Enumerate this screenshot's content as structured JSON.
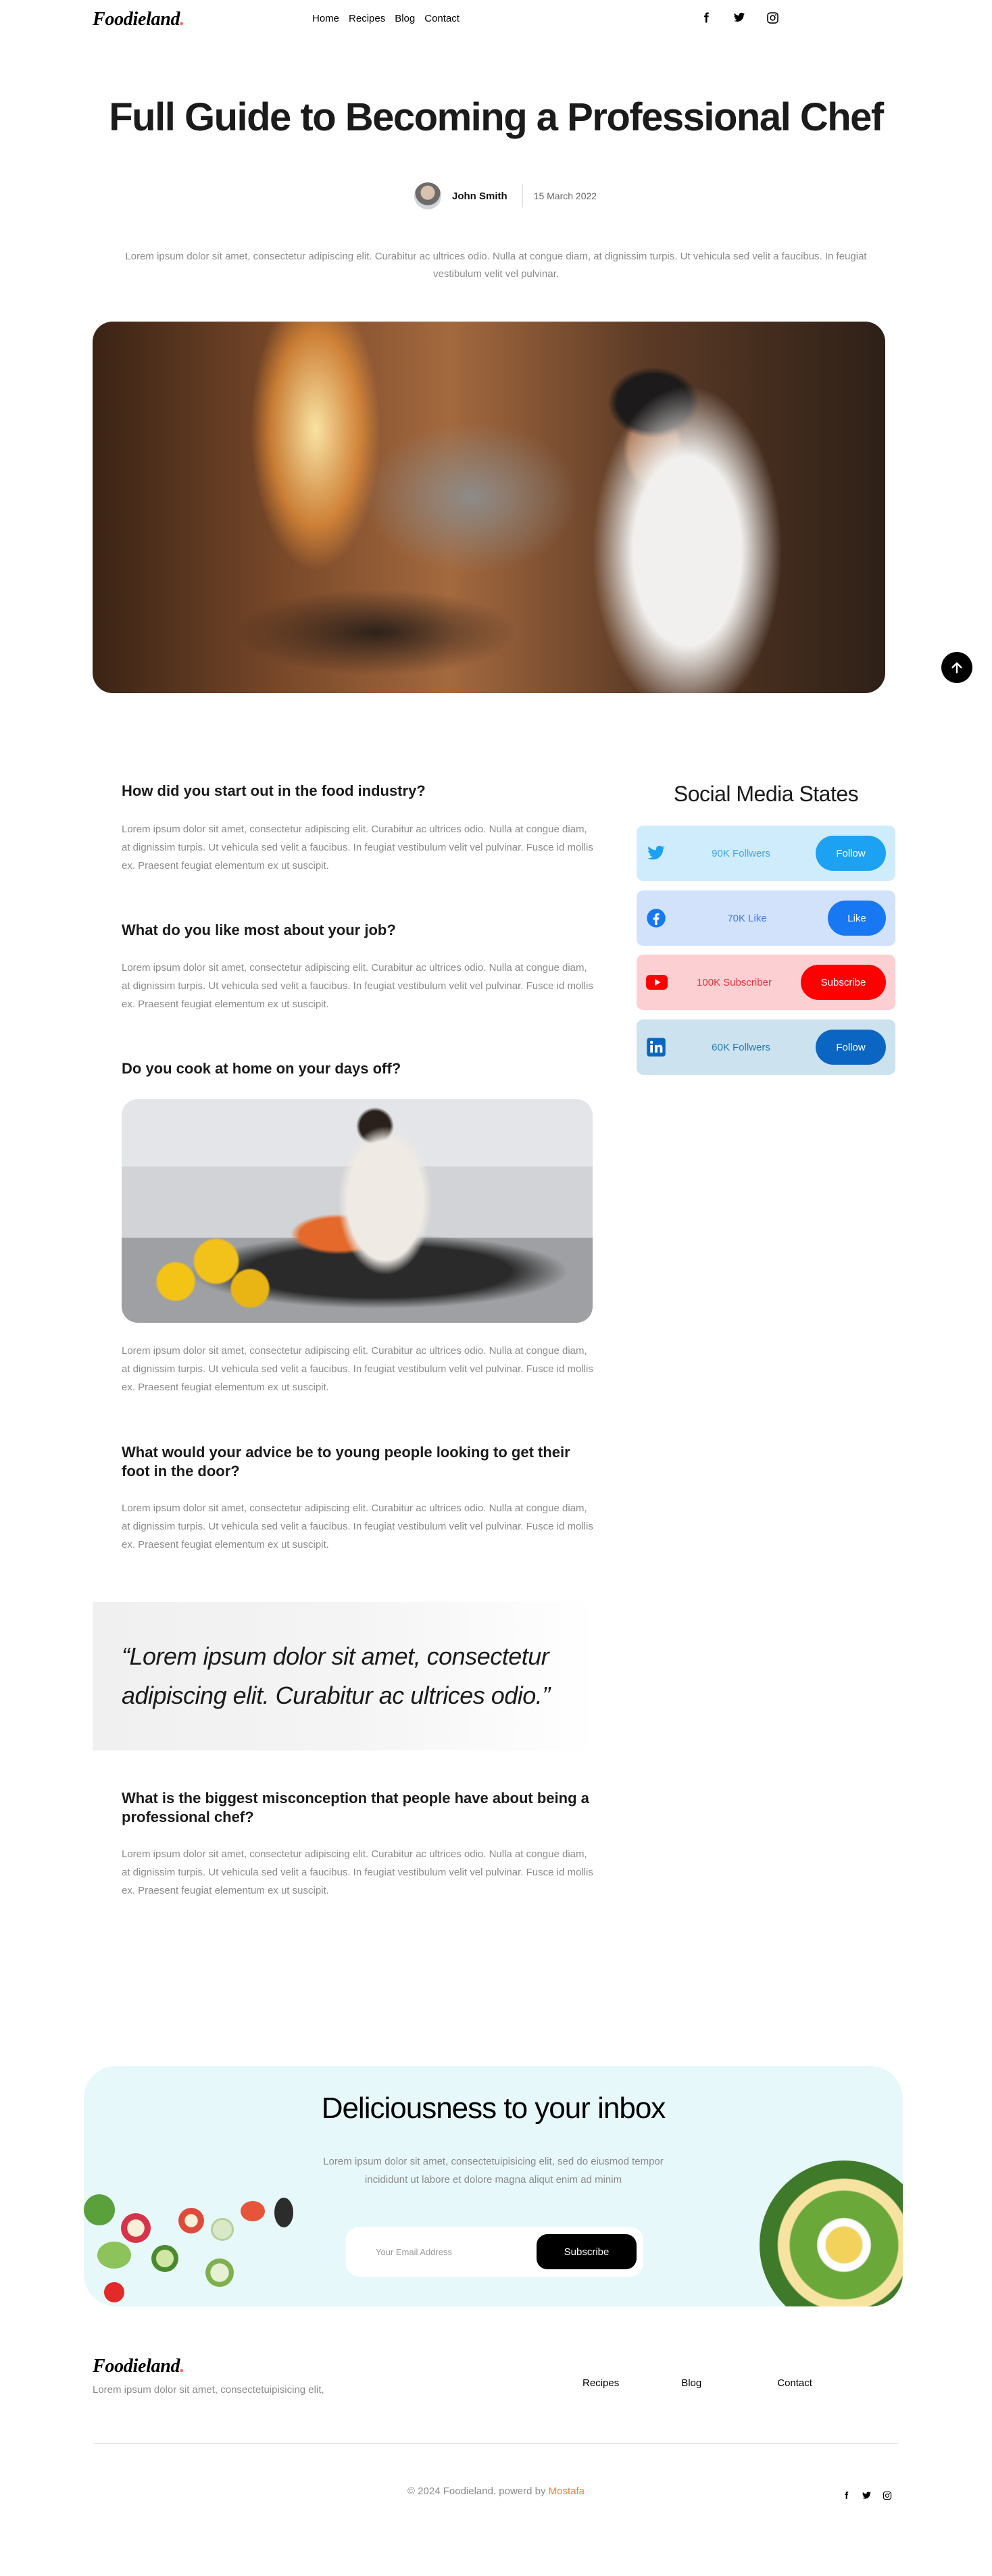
{
  "header": {
    "logo": "Foodieland",
    "logo_dot": ".",
    "nav": [
      "Home",
      "Recipes",
      "Blog",
      "Contact"
    ],
    "social_icons": [
      "facebook-icon",
      "twitter-icon",
      "instagram-icon"
    ]
  },
  "article": {
    "title": "Full Guide to Becoming a Professional Chef",
    "author": "John Smith",
    "date": "15 March 2022",
    "intro": "Lorem ipsum dolor sit amet, consectetur adipiscing elit. Curabitur ac ultrices odio. Nulla at congue diam, at dignissim turpis. Ut vehicula sed velit a faucibus. In feugiat vestibulum velit vel pulvinar.",
    "sections": [
      {
        "question": "How did you start out in the food industry?",
        "text": "Lorem ipsum dolor sit amet, consectetur adipiscing elit. Curabitur ac ultrices odio. Nulla at congue diam, at dignissim turpis. Ut vehicula sed velit a faucibus. In feugiat vestibulum velit vel pulvinar. Fusce id mollis ex. Praesent feugiat elementum ex ut suscipit."
      },
      {
        "question": "What do you like most about your job?",
        "text": "Lorem ipsum dolor sit amet, consectetur adipiscing elit. Curabitur ac ultrices odio. Nulla at congue diam, at dignissim turpis. Ut vehicula sed velit a faucibus. In feugiat vestibulum velit vel pulvinar. Fusce id mollis ex. Praesent feugiat elementum ex ut suscipit."
      },
      {
        "question": "Do you cook at home on your days off?",
        "text": "Lorem ipsum dolor sit amet, consectetur adipiscing elit. Curabitur ac ultrices odio. Nulla at congue diam, at dignissim turpis. Ut vehicula sed velit a faucibus. In feugiat vestibulum velit vel pulvinar. Fusce id mollis ex. Praesent feugiat elementum ex ut suscipit."
      },
      {
        "question": "What would your advice be to young people looking to get their foot in the door?",
        "text": "Lorem ipsum dolor sit amet, consectetur adipiscing elit. Curabitur ac ultrices odio. Nulla at congue diam, at dignissim turpis. Ut vehicula sed velit a faucibus. In feugiat vestibulum velit vel pulvinar. Fusce id mollis ex. Praesent feugiat elementum ex ut suscipit."
      },
      {
        "question": "What is the biggest misconception that people have about being a professional chef?",
        "text": "Lorem ipsum dolor sit amet, consectetur adipiscing elit. Curabitur ac ultrices odio. Nulla at congue diam, at dignissim turpis. Ut vehicula sed velit a faucibus. In feugiat vestibulum velit vel pulvinar. Fusce id mollis ex. Praesent feugiat elementum ex ut suscipit."
      }
    ],
    "quote": "“Lorem ipsum dolor sit amet, consectetur adipiscing elit. Curabitur ac ultrices odio.”"
  },
  "sidebar": {
    "title": "Social Media States",
    "cards": [
      {
        "icon": "twitter-icon",
        "count": "90K Follwers",
        "button": "Follow",
        "bg": "#cfecfc",
        "text_color": "#3aa7e8",
        "btn_color": "#1da1f2"
      },
      {
        "icon": "facebook-icon",
        "count": "70K Like",
        "button": "Like",
        "bg": "#d3e2fb",
        "text_color": "#3c7ce4",
        "btn_color": "#1877f2"
      },
      {
        "icon": "youtube-icon",
        "count": "100K Subscriber",
        "button": "Subscribe",
        "bg": "#fccfd3",
        "text_color": "#e0353f",
        "btn_color": "#ff0000"
      },
      {
        "icon": "linkedin-icon",
        "count": "60K Follwers",
        "button": "Follow",
        "bg": "#cde2ef",
        "text_color": "#1f7ab4",
        "btn_color": "#0a66c2"
      }
    ]
  },
  "newsletter": {
    "title": "Deliciousness to your inbox",
    "description": "Lorem ipsum dolor sit amet, consectetuipisicing elit, sed do eiusmod tempor incididunt ut labore et dolore magna aliqut enim ad minim",
    "email_placeholder": "Your Email Address",
    "button": "Subscribe"
  },
  "footer": {
    "logo": "Foodieland",
    "logo_dot": ".",
    "description": "Lorem ipsum dolor sit amet, consectetuipisicing elit,",
    "links": [
      "Recipes",
      "Blog",
      "Contact"
    ],
    "copyright_prefix": "© 2024 Foodieland. powerd by",
    "copyright_link": "Mostafa",
    "social_icons": [
      "facebook-icon",
      "twitter-icon",
      "instagram-icon"
    ]
  },
  "colors": {
    "accent": "#ff7a30",
    "logo_dot": "#ff6363",
    "newsletter_bg": "#e7f8fb"
  }
}
